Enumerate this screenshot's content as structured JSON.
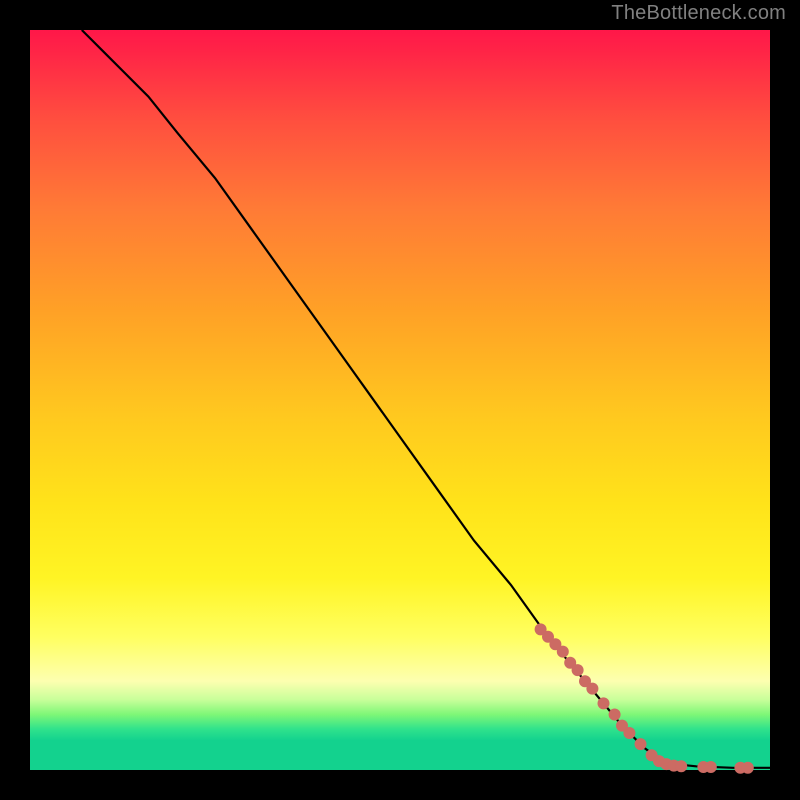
{
  "attribution": "TheBottleneck.com",
  "chart_data": {
    "type": "line",
    "title": "",
    "xlabel": "",
    "ylabel": "",
    "xlim": [
      0,
      100
    ],
    "ylim": [
      0,
      100
    ],
    "curve": [
      {
        "x": 7,
        "y": 100
      },
      {
        "x": 8,
        "y": 99
      },
      {
        "x": 10,
        "y": 97
      },
      {
        "x": 13,
        "y": 94
      },
      {
        "x": 16,
        "y": 91
      },
      {
        "x": 20,
        "y": 86
      },
      {
        "x": 25,
        "y": 80
      },
      {
        "x": 30,
        "y": 73
      },
      {
        "x": 35,
        "y": 66
      },
      {
        "x": 40,
        "y": 59
      },
      {
        "x": 45,
        "y": 52
      },
      {
        "x": 50,
        "y": 45
      },
      {
        "x": 55,
        "y": 38
      },
      {
        "x": 60,
        "y": 31
      },
      {
        "x": 65,
        "y": 25
      },
      {
        "x": 70,
        "y": 18
      },
      {
        "x": 75,
        "y": 12
      },
      {
        "x": 80,
        "y": 6
      },
      {
        "x": 83,
        "y": 3
      },
      {
        "x": 85,
        "y": 1.5
      },
      {
        "x": 87,
        "y": 0.8
      },
      {
        "x": 90,
        "y": 0.5
      },
      {
        "x": 95,
        "y": 0.3
      },
      {
        "x": 100,
        "y": 0.3
      }
    ],
    "series": [
      {
        "name": "markers",
        "points": [
          {
            "x": 69,
            "y": 19
          },
          {
            "x": 70,
            "y": 18
          },
          {
            "x": 71,
            "y": 17
          },
          {
            "x": 72,
            "y": 16
          },
          {
            "x": 73,
            "y": 14.5
          },
          {
            "x": 74,
            "y": 13.5
          },
          {
            "x": 75,
            "y": 12
          },
          {
            "x": 76,
            "y": 11
          },
          {
            "x": 77.5,
            "y": 9
          },
          {
            "x": 79,
            "y": 7.5
          },
          {
            "x": 80,
            "y": 6
          },
          {
            "x": 81,
            "y": 5
          },
          {
            "x": 82.5,
            "y": 3.5
          },
          {
            "x": 84,
            "y": 2
          },
          {
            "x": 85,
            "y": 1.2
          },
          {
            "x": 86,
            "y": 0.8
          },
          {
            "x": 87,
            "y": 0.6
          },
          {
            "x": 88,
            "y": 0.5
          },
          {
            "x": 91,
            "y": 0.4
          },
          {
            "x": 92,
            "y": 0.4
          },
          {
            "x": 96,
            "y": 0.3
          },
          {
            "x": 97,
            "y": 0.3
          }
        ]
      }
    ],
    "marker_radius": 6
  },
  "colors": {
    "dot": "#cc6b63",
    "line": "#000000",
    "attribution": "#808080"
  }
}
